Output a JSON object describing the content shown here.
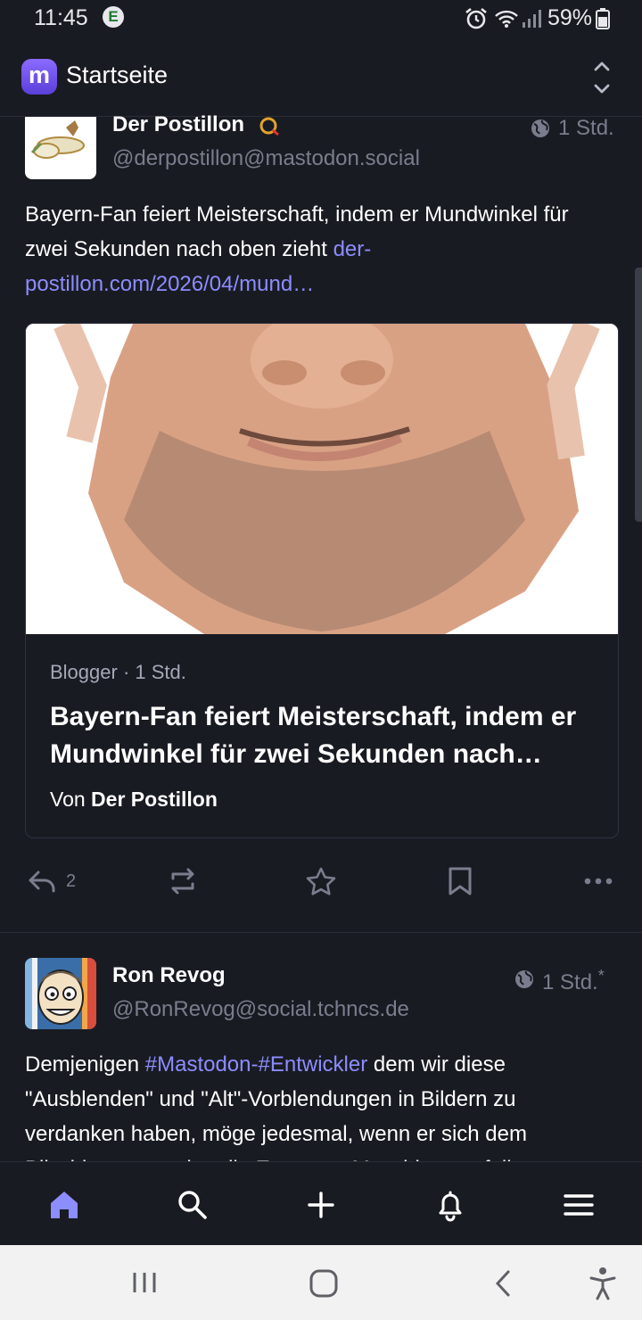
{
  "status_bar": {
    "time": "11:45",
    "e_badge": "E",
    "battery": "59%"
  },
  "header": {
    "title": "Startseite",
    "logo_letter": "m"
  },
  "posts": [
    {
      "name": "Der Postillon",
      "badge": "Q",
      "handle": "@derpostillon@mastodon.social",
      "time": "1 Std.",
      "text": "Bayern-Fan feiert Meisterschaft, indem er Mundwinkel für zwei Sekunden nach oben zieht ",
      "link": "der-postillon.com/2026/04/mund…",
      "card": {
        "meta": "Blogger · 1 Std.",
        "title": "Bayern-Fan feiert Meisterschaft, indem er Mundwinkel für zwei Sekunden nach…",
        "author_prefix": "Von ",
        "author": "Der Postillon"
      },
      "reply_count": "2"
    },
    {
      "name": "Ron Revog",
      "handle": "@RonRevog@social.tchncs.de",
      "time": "1 Std.",
      "edited_mark": "*",
      "hashtag": "#Mastodon-#Entwickler",
      "text_before": "Demjenigen ",
      "text_after": " dem wir diese \"Ausblenden\" und \"Alt\"-Vorblendungen in Bildern zu verdanken haben, möge jedesmal, wenn er sich dem Bilschirm zuwendet, die Espresso-Maschine ausfallen..."
    }
  ],
  "icons": {
    "globe": "globe-icon",
    "reply": "reply-icon",
    "boost": "boost-icon",
    "favourite": "star-icon",
    "bookmark": "bookmark-icon",
    "more": "more-icon",
    "home": "home-icon",
    "search": "search-icon",
    "compose": "plus-icon",
    "notifications": "bell-icon",
    "menu": "menu-icon"
  },
  "colors": {
    "background": "#191b22",
    "accent": "#8c8dff",
    "muted": "#7a7d8d",
    "active_nav": "#8c8dff"
  }
}
